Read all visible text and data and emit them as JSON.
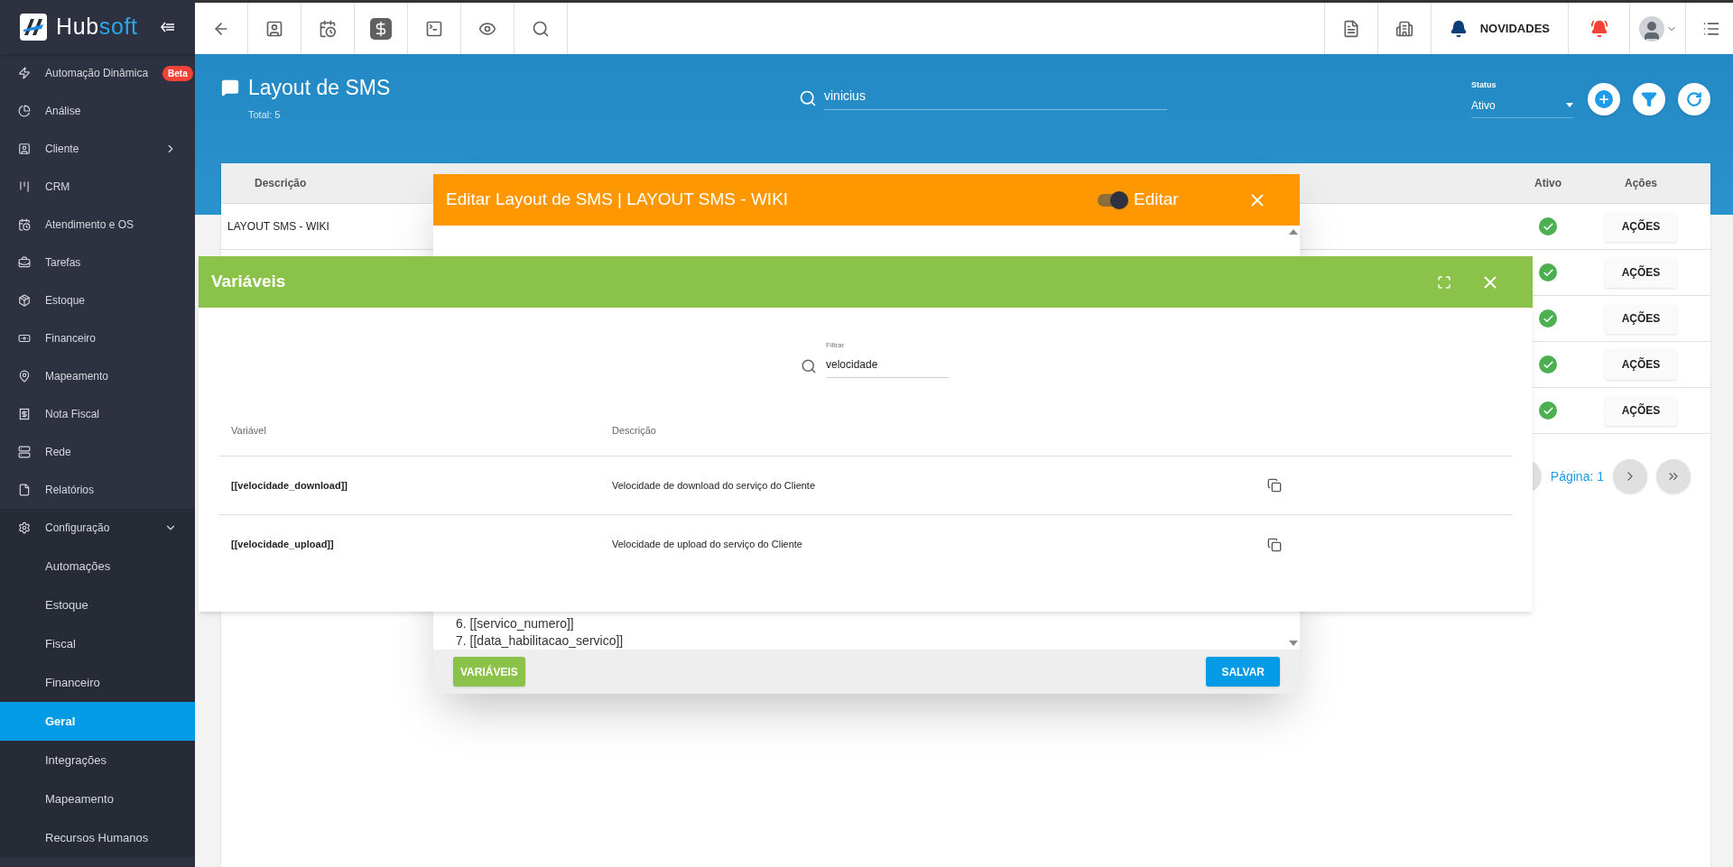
{
  "sidebar": {
    "logo": {
      "first": "Hub",
      "second": "soft"
    },
    "items": [
      {
        "label": "Automação Dinâmica",
        "badge": "Beta"
      },
      {
        "label": "Análise"
      },
      {
        "label": "Cliente",
        "kind": "group",
        "expanded": false
      },
      {
        "label": "CRM"
      },
      {
        "label": "Atendimento e OS"
      },
      {
        "label": "Tarefas"
      },
      {
        "label": "Estoque"
      },
      {
        "label": "Financeiro"
      },
      {
        "label": "Mapeamento"
      },
      {
        "label": "Nota Fiscal"
      },
      {
        "label": "Rede"
      },
      {
        "label": "Relatórios"
      },
      {
        "label": "Configuração",
        "kind": "group",
        "expanded": true,
        "children": [
          {
            "label": "Automações",
            "selected": false
          },
          {
            "label": "Estoque",
            "selected": false
          },
          {
            "label": "Fiscal",
            "selected": false
          },
          {
            "label": "Financeiro",
            "selected": false
          },
          {
            "label": "Geral",
            "selected": true
          },
          {
            "label": "Integrações",
            "selected": false
          },
          {
            "label": "Mapeamento",
            "selected": false
          },
          {
            "label": "Recursos Humanos",
            "selected": false
          }
        ]
      }
    ]
  },
  "topbar": {
    "news_label": "NOVIDADES"
  },
  "header": {
    "title": "Layout de SMS",
    "total": "Total: 5",
    "search": {
      "value": "vinicius"
    },
    "status": {
      "label": "Status",
      "value": "Ativo"
    }
  },
  "table": {
    "columns": [
      "Descrição",
      "Ativo",
      "Ações"
    ],
    "rows": [
      {
        "description": "LAYOUT SMS - WIKI",
        "active": true,
        "action": "AÇÕES"
      },
      {
        "active": true,
        "action": "AÇÕES"
      },
      {
        "active": true,
        "action": "AÇÕES"
      },
      {
        "active": true,
        "action": "AÇÕES"
      },
      {
        "active": true,
        "action": "AÇÕES"
      }
    ],
    "pagination": {
      "page_label": "Página: 1"
    }
  },
  "edit_dialog": {
    "title": "Editar Layout de SMS | LAYOUT SMS - WIKI",
    "edit_toggle": {
      "label": "Editar",
      "on": true
    },
    "lines": [
      "6. [[servico_numero]]",
      "7. [[data_habilitacao_servico]]"
    ],
    "variables_button": "VARIÁVEIS",
    "save_button": "SALVAR"
  },
  "variables_dialog": {
    "title": "Variáveis",
    "filter": {
      "label": "Filtrar",
      "value": "velocidade"
    },
    "columns": [
      "Variável",
      "Descrição"
    ],
    "rows": [
      {
        "variable": "[[velocidade_download]]",
        "description": "Velocidade de download do serviço do Cliente"
      },
      {
        "variable": "[[velocidade_upload]]",
        "description": "Velocidade de upload do serviço do Cliente"
      }
    ]
  }
}
